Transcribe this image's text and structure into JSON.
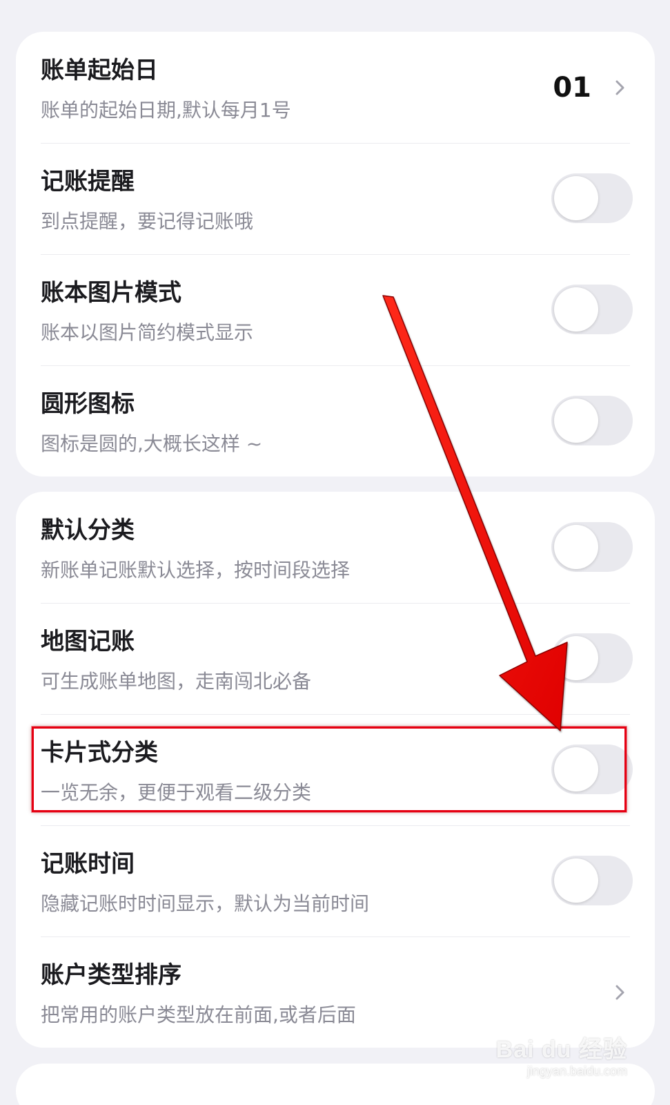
{
  "card1": {
    "rows": [
      {
        "title": "账单起始日",
        "subtitle": "账单的起始日期,默认每月1号",
        "value": "01",
        "control": "chevron"
      },
      {
        "title": "记账提醒",
        "subtitle": "到点提醒，要记得记账哦",
        "control": "toggle",
        "on": false
      },
      {
        "title": "账本图片模式",
        "subtitle": "账本以图片简约模式显示",
        "control": "toggle",
        "on": false
      },
      {
        "title": "圆形图标",
        "subtitle": "图标是圆的,大概长这样 ~",
        "control": "toggle",
        "on": false
      }
    ]
  },
  "card2": {
    "rows": [
      {
        "title": "默认分类",
        "subtitle": "新账单记账默认选择，按时间段选择",
        "control": "toggle",
        "on": false
      },
      {
        "title": "地图记账",
        "subtitle": "可生成账单地图，走南闯北必备",
        "control": "toggle",
        "on": false
      },
      {
        "title": "卡片式分类",
        "subtitle": "一览无余，更便于观看二级分类",
        "control": "toggle",
        "on": false
      },
      {
        "title": "记账时间",
        "subtitle": "隐藏记账时时间显示，默认为当前时间",
        "control": "toggle",
        "on": false
      },
      {
        "title": "账户类型排序",
        "subtitle": "把常用的账户类型放在前面,或者后面",
        "control": "chevron"
      }
    ]
  },
  "colors": {
    "background": "#f1f1f6",
    "card": "#ffffff",
    "toggle_off": "#e9e9ee",
    "annotation_red": "#e60012"
  },
  "watermark": {
    "logo": "Bai du 经验",
    "url": "jingyan.baidu.com"
  }
}
